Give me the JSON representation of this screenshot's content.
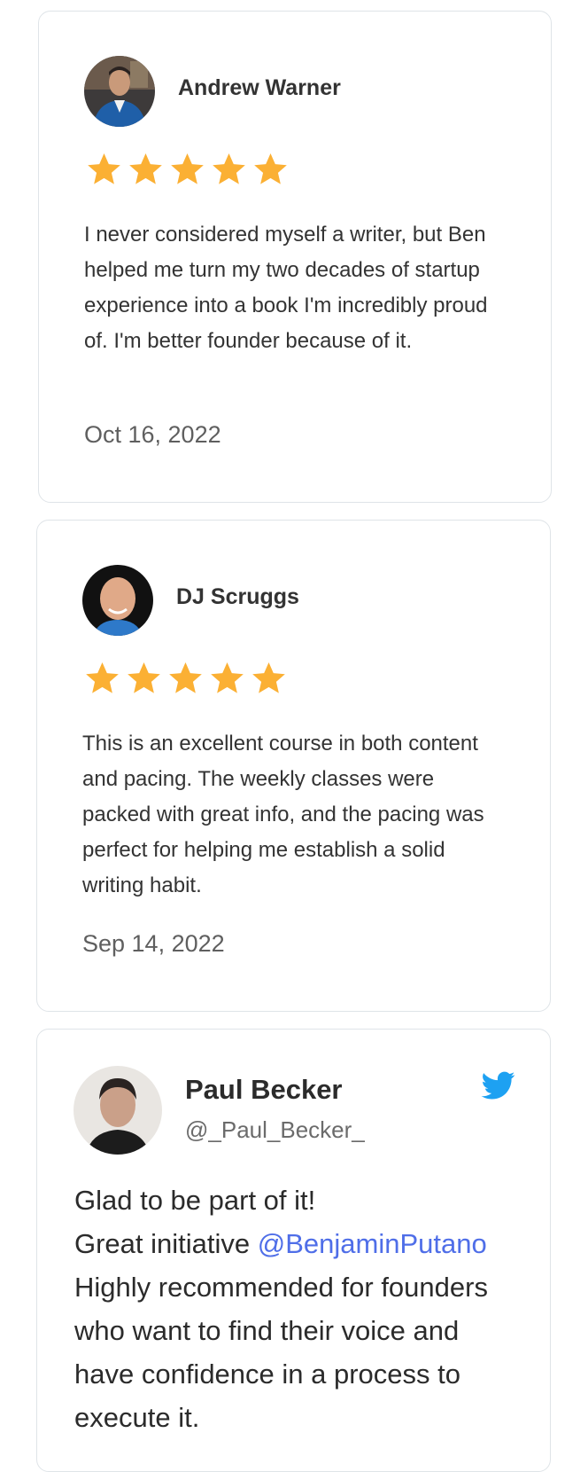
{
  "reviews": [
    {
      "name": "Andrew Warner",
      "rating": 5,
      "text": "I never considered myself a writer, but Ben helped me turn my two decades of startup experience into a book I'm incredibly proud of. I'm better founder because of it.",
      "date": "Oct 16, 2022"
    },
    {
      "name": "DJ Scruggs",
      "rating": 5,
      "text": "This is an excellent course in both content and pacing. The weekly classes were packed with great info, and the pacing was perfect for helping me establish a solid writing habit.",
      "date": "Sep 14, 2022"
    }
  ],
  "tweet": {
    "name": "Paul Becker",
    "handle": "@_Paul_Becker_",
    "line1": "Glad to be part of it!",
    "line2_prefix": "Great initiative ",
    "mention": "@BenjaminPutano",
    "line3": "Highly recommended for founders",
    "line4": "who want to find their voice and",
    "line5": "have confidence in a process to",
    "line6": "execute it."
  },
  "colors": {
    "star": "#fbb034",
    "mention": "#4f6ee8",
    "twitter": "#1da1f2",
    "card_border": "#dfe4e8"
  },
  "icons": [
    "star-icon",
    "twitter-bird-icon"
  ]
}
